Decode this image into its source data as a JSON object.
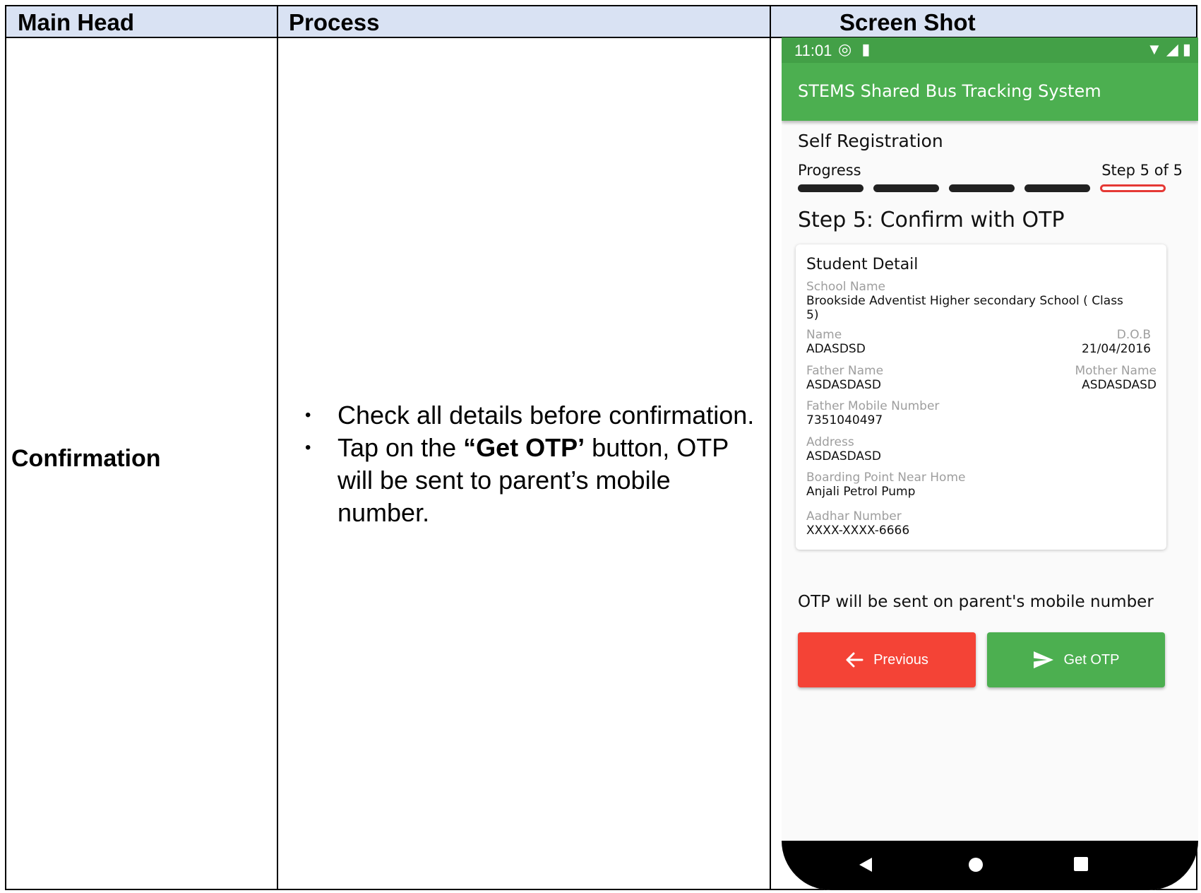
{
  "table": {
    "headers": [
      "Main Head",
      "Process",
      "Screen Shot"
    ],
    "main_head": "Confirmation",
    "process": [
      {
        "text": "Check all details before confirmation."
      },
      {
        "pre": "Tap on the ",
        "bold": "“Get OTP’",
        "post": " button, OTP will be sent to parent’s mobile number."
      }
    ]
  },
  "phone": {
    "status": {
      "time": "11:01"
    },
    "app_title": "STEMS Shared Bus Tracking System",
    "registration_title": "Self Registration",
    "progress_label": "Progress",
    "step_label": "Step 5 of 5",
    "progress": {
      "current_step": 5,
      "total_steps": 5
    },
    "step_heading": "Step 5: Confirm with OTP",
    "card": {
      "title": "Student Detail",
      "school_name_label": "School Name",
      "school_name_line1": "Brookside Adventist Higher secondary School ( Class",
      "school_name_line2": "5)",
      "name_label": "Name",
      "name_value": "ADASDSD",
      "dob_label": "D.O.B",
      "dob_value": "21/04/2016",
      "father_label": "Father Name",
      "father_value": "ASDASDASD",
      "mother_label": "Mother Name",
      "mother_value": "ASDASDASD",
      "father_mobile_label": "Father Mobile Number",
      "father_mobile_value": "7351040497",
      "address_label": "Address",
      "address_value": "ASDASDASD",
      "boarding_label": "Boarding Point Near Home",
      "boarding_value": "Anjali Petrol Pump",
      "aadhar_label": "Aadhar Number",
      "aadhar_value": "XXXX-XXXX-6666"
    },
    "otp_note": "OTP will be sent on parent's mobile number",
    "buttons": {
      "previous": "Previous",
      "get_otp": "Get OTP"
    },
    "icons": [
      "sync-icon",
      "sd-card-icon",
      "wifi-icon",
      "signal-icon",
      "battery-icon",
      "arrow-left-icon",
      "send-icon",
      "nav-back-icon",
      "nav-home-icon",
      "nav-recents-icon"
    ],
    "colors": {
      "green": "#4caf50",
      "red": "#f44336",
      "progress_active_border": "#e53935"
    }
  }
}
